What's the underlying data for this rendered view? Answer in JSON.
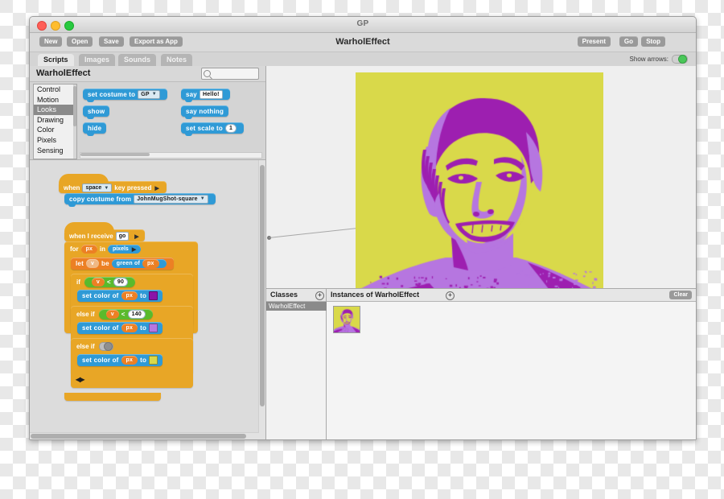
{
  "window": {
    "app_title": "GP",
    "document_title": "WarholEffect",
    "traffic_lights": [
      "close",
      "minimize",
      "zoom"
    ]
  },
  "toolbar": {
    "new_label": "New",
    "open_label": "Open",
    "save_label": "Save",
    "export_label": "Export as App",
    "present_label": "Present",
    "go_label": "Go",
    "stop_label": "Stop"
  },
  "tabs": [
    {
      "label": "Scripts",
      "active": true
    },
    {
      "label": "Images",
      "active": false
    },
    {
      "label": "Sounds",
      "active": false
    },
    {
      "label": "Notes",
      "active": false
    }
  ],
  "show_arrows": {
    "label": "Show arrows:",
    "on": true,
    "color": "#4ac759"
  },
  "editor": {
    "class_name": "WarholEffect",
    "search_placeholder": "",
    "search_value": "",
    "search_icon": "magnifier-icon"
  },
  "categories": [
    {
      "label": "Control",
      "selected": false
    },
    {
      "label": "Motion",
      "selected": false
    },
    {
      "label": "Looks",
      "selected": true
    },
    {
      "label": "Drawing",
      "selected": false
    },
    {
      "label": "Color",
      "selected": false
    },
    {
      "label": "Pixels",
      "selected": false
    },
    {
      "label": "Sensing",
      "selected": false
    }
  ],
  "palette_blocks": [
    {
      "id": "set-costume-to",
      "text_before": "set costume to",
      "dropdown": "GP",
      "color": "#2f9ad6"
    },
    {
      "id": "show",
      "text_before": "show",
      "color": "#2f9ad6"
    },
    {
      "id": "hide",
      "text_before": "hide",
      "color": "#2f9ad6"
    },
    {
      "id": "say",
      "text_before": "say",
      "field": "Hello!",
      "color": "#2f9ad6"
    },
    {
      "id": "say-nothing",
      "text_before": "say nothing",
      "color": "#2f9ad6"
    },
    {
      "id": "set-scale-to",
      "text_before": "set scale to",
      "number": "1",
      "color": "#2f9ad6"
    }
  ],
  "script_one": {
    "hat_text_a": "when",
    "hat_dropdown": "space",
    "hat_text_b": "key pressed",
    "body_text": "copy costume from",
    "body_dropdown": "JohnMugShot-square"
  },
  "script_two": {
    "hat_text": "when I receive",
    "hat_field": "go",
    "for_text_a": "for",
    "for_var": "px",
    "for_text_b": "in",
    "for_list": "pixels",
    "let_text_a": "let",
    "let_var": "v",
    "let_text_b": "be",
    "let_expr_a": "green of",
    "let_expr_b": "px",
    "if_text": "if",
    "if_var": "v",
    "if_op": "<",
    "if_num": "90",
    "set1_text_a": "set color of",
    "set1_var": "px",
    "set1_text_b": "to",
    "set1_color": "#8a14a8",
    "elif1_text": "else if",
    "elif1_var": "v",
    "elif1_op": "<",
    "elif1_num": "140",
    "set2_text_a": "set color of",
    "set2_var": "px",
    "set2_text_b": "to",
    "set2_color": "#b676e0",
    "elif2_text": "else if",
    "set3_text_a": "set color of",
    "set3_var": "px",
    "set3_text_b": "to",
    "set3_color": "#d9d94a",
    "expand_arrows": "◀▶"
  },
  "stage": {
    "image_alt": "warhol-portrait",
    "background_color": "#d9d94a",
    "midtone_color": "#b676e0",
    "shadow_color": "#9d1fb0"
  },
  "classes_panel": {
    "title": "Classes",
    "add_icon": "plus-circle-icon",
    "items": [
      {
        "label": "WarholEffect",
        "selected": true
      }
    ]
  },
  "instances_panel": {
    "title": "Instances of WarholEffect",
    "add_icon": "plus-circle-icon",
    "clear_label": "Clear",
    "instances": [
      {
        "label": "warhol-instance-thumbnail"
      }
    ]
  }
}
